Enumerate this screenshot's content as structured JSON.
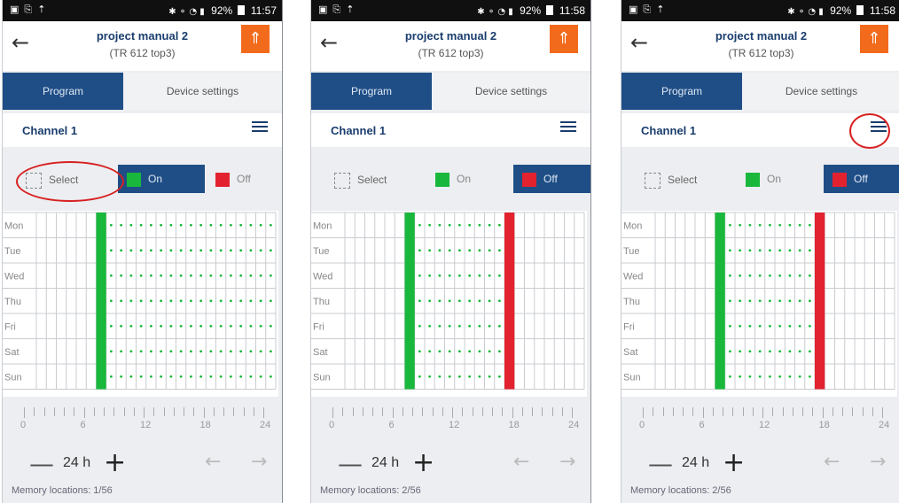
{
  "phones": [
    {
      "status_time": "11:57",
      "status_battery": "92%",
      "title": "project manual 2",
      "subtitle": "(TR 612 top3)",
      "tab_program": "Program",
      "tab_device": "Device settings",
      "channel": "Channel 1",
      "mode_select": "Select",
      "mode_on": "On",
      "mode_off": "Off",
      "active_mode": "on",
      "memory": "Memory locations: 1/56",
      "zoom": "24 h",
      "program": {
        "on_from": 6,
        "dotted_to": 24,
        "off_at": null
      }
    },
    {
      "status_time": "11:58",
      "status_battery": "92%",
      "title": "project manual 2",
      "subtitle": "(TR 612 top3)",
      "tab_program": "Program",
      "tab_device": "Device settings",
      "channel": "Channel 1",
      "mode_select": "Select",
      "mode_on": "On",
      "mode_off": "Off",
      "active_mode": "off",
      "memory": "Memory locations: 2/56",
      "zoom": "24 h",
      "program": {
        "on_from": 6,
        "dotted_to": 16,
        "off_at": 16
      }
    },
    {
      "status_time": "11:58",
      "status_battery": "92%",
      "title": "project manual 2",
      "subtitle": "(TR 612 top3)",
      "tab_program": "Program",
      "tab_device": "Device settings",
      "channel": "Channel 1",
      "mode_select": "Select",
      "mode_on": "On",
      "mode_off": "Off",
      "active_mode": "off",
      "memory": "Memory locations: 2/56",
      "zoom": "24 h",
      "program": {
        "on_from": 6,
        "dotted_to": 16,
        "off_at": 16
      }
    }
  ],
  "days": [
    "Mon",
    "Tue",
    "Wed",
    "Thu",
    "Fri",
    "Sat",
    "Sun"
  ],
  "axis_ticks": [
    "0",
    "6",
    "12",
    "18",
    "24"
  ],
  "colors": {
    "on": "#19b83c",
    "off": "#e3222f",
    "primary": "#1f4e86",
    "upload": "#f26b1d",
    "annotation": "#d82020"
  },
  "icons": {
    "back": "arrow-left-icon",
    "upload": "upload-signal-icon",
    "list": "list-icon",
    "minus": "minus-icon",
    "plus": "plus-icon",
    "prev": "arrow-left-icon",
    "next": "arrow-right-icon"
  }
}
